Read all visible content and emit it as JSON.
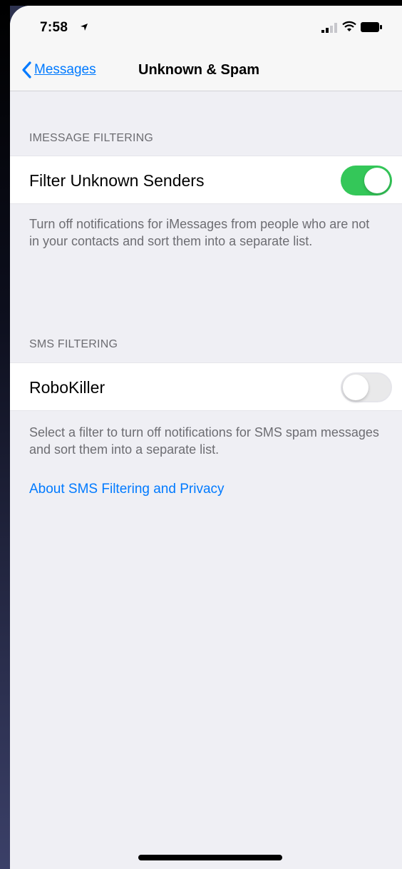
{
  "status_bar": {
    "time": "7:58",
    "icons": [
      "location-arrow-icon",
      "signal-icon",
      "wifi-icon",
      "battery-icon"
    ]
  },
  "nav": {
    "back_label": "Messages",
    "title": "Unknown & Spam"
  },
  "sections": {
    "imessage": {
      "header": "IMESSAGE FILTERING",
      "row_label": "Filter Unknown Senders",
      "toggle_on": true,
      "footer": "Turn off notifications for iMessages from people who are not in your contacts and sort them into a separate list."
    },
    "sms": {
      "header": "SMS FILTERING",
      "row_label": "RoboKiller",
      "toggle_on": false,
      "footer": "Select a filter to turn off notifications for SMS spam messages and sort them into a separate list.",
      "link": "About SMS Filtering and Privacy"
    }
  },
  "colors": {
    "accent": "#007aff",
    "toggle_on": "#34c759",
    "background": "#efeff4"
  }
}
